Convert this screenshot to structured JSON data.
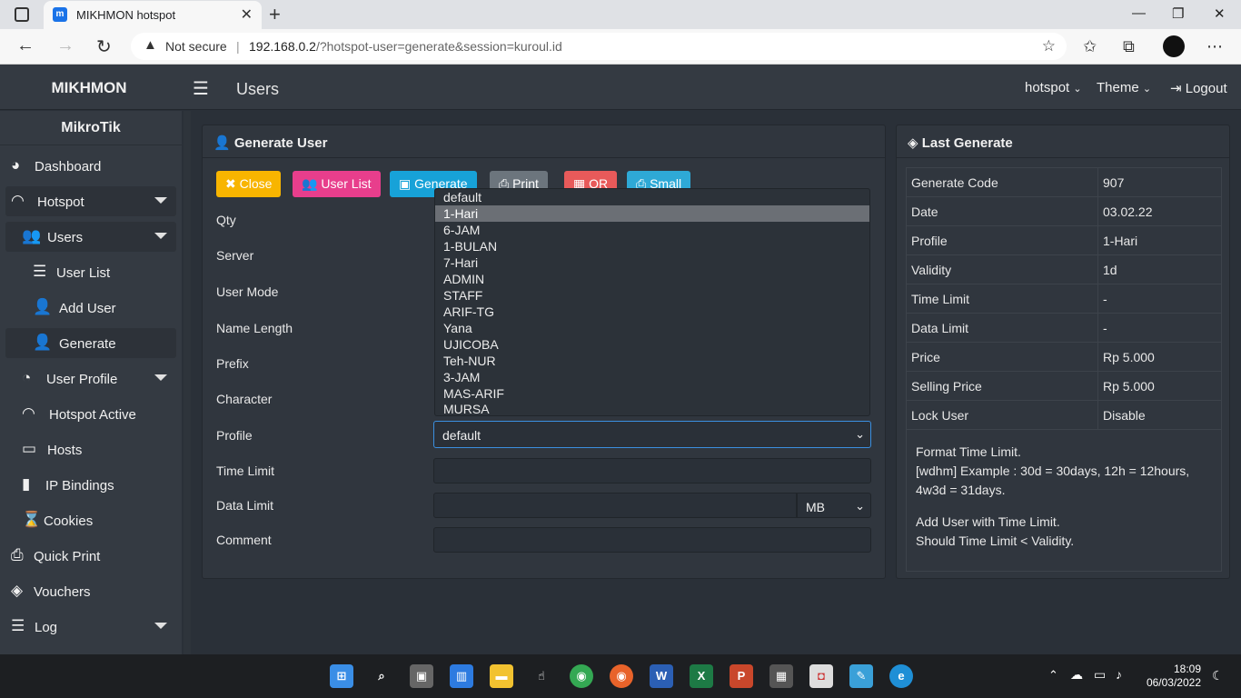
{
  "browser": {
    "tab_title": "MIKHMON hotspot",
    "not_secure": "Not secure",
    "url_host": "192.168.0.2",
    "url_path": "/?hotspot-user=generate&session=kuroul.id"
  },
  "header": {
    "brand": "MIKHMON",
    "title": "Users",
    "session": "hotspot",
    "theme": "Theme",
    "logout": "Logout"
  },
  "sidebar": {
    "brand": "MikroTik",
    "items": [
      {
        "label": "Dashboard",
        "icon": "dashboard-icon"
      },
      {
        "label": "Hotspot",
        "icon": "wifi-icon"
      },
      {
        "label": "Users",
        "icon": "users-icon"
      },
      {
        "label": "User List",
        "icon": "list-icon"
      },
      {
        "label": "Add User",
        "icon": "user-plus-icon"
      },
      {
        "label": "Generate",
        "icon": "user-plus-icon"
      },
      {
        "label": "User Profile",
        "icon": "pie-chart-icon"
      },
      {
        "label": "Hotspot Active",
        "icon": "wifi-icon"
      },
      {
        "label": "Hosts",
        "icon": "laptop-icon"
      },
      {
        "label": "IP Bindings",
        "icon": "address-card-icon"
      },
      {
        "label": "Cookies",
        "icon": "hourglass-icon"
      },
      {
        "label": "Quick Print",
        "icon": "print-icon"
      },
      {
        "label": "Vouchers",
        "icon": "ticket-icon"
      },
      {
        "label": "Log",
        "icon": "list-icon"
      }
    ]
  },
  "generate": {
    "title": "Generate User",
    "buttons": {
      "close": "Close",
      "user_list": "User List",
      "generate": "Generate",
      "print": "Print",
      "qr": "QR",
      "small": "Small"
    },
    "labels": {
      "qty": "Qty",
      "server": "Server",
      "user_mode": "User Mode",
      "name_length": "Name Length",
      "prefix": "Prefix",
      "character": "Character",
      "profile": "Profile",
      "time_limit": "Time Limit",
      "data_limit": "Data Limit",
      "comment": "Comment"
    },
    "profile_selected": "default",
    "data_unit": "MB",
    "profile_options": [
      "default",
      "1-Hari",
      "6-JAM",
      "1-BULAN",
      "7-Hari",
      "ADMIN",
      "STAFF",
      "ARIF-TG",
      "Yana",
      "UJICOBA",
      "Teh-NUR",
      "3-JAM",
      "MAS-ARIF",
      "MURSA"
    ],
    "highlighted_option": "1-Hari"
  },
  "last_generate": {
    "title": "Last Generate",
    "rows": [
      {
        "key": "Generate Code",
        "value": "907"
      },
      {
        "key": "Date",
        "value": "03.02.22"
      },
      {
        "key": "Profile",
        "value": "1-Hari"
      },
      {
        "key": "Validity",
        "value": "1d"
      },
      {
        "key": "Time Limit",
        "value": "-"
      },
      {
        "key": "Data Limit",
        "value": "-"
      },
      {
        "key": "Price",
        "value": "Rp 5.000"
      },
      {
        "key": "Selling Price",
        "value": "Rp 5.000"
      },
      {
        "key": "Lock User",
        "value": "Disable"
      }
    ],
    "note_1": "Format Time Limit.",
    "note_2": "[wdhm] Example : 30d = 30days, 12h = 12hours, 4w3d = 31days.",
    "note_3": "Add User with Time Limit.",
    "note_4": "Should Time Limit < Validity."
  },
  "taskbar": {
    "time": "18:09",
    "date": "06/03/2022"
  },
  "colors": {
    "close": "#f8b500",
    "user_list": "#e83e8c",
    "generate": "#17a2d8",
    "print": "#6c757d",
    "qr": "#e85a5a",
    "small": "#2ea9d6"
  }
}
